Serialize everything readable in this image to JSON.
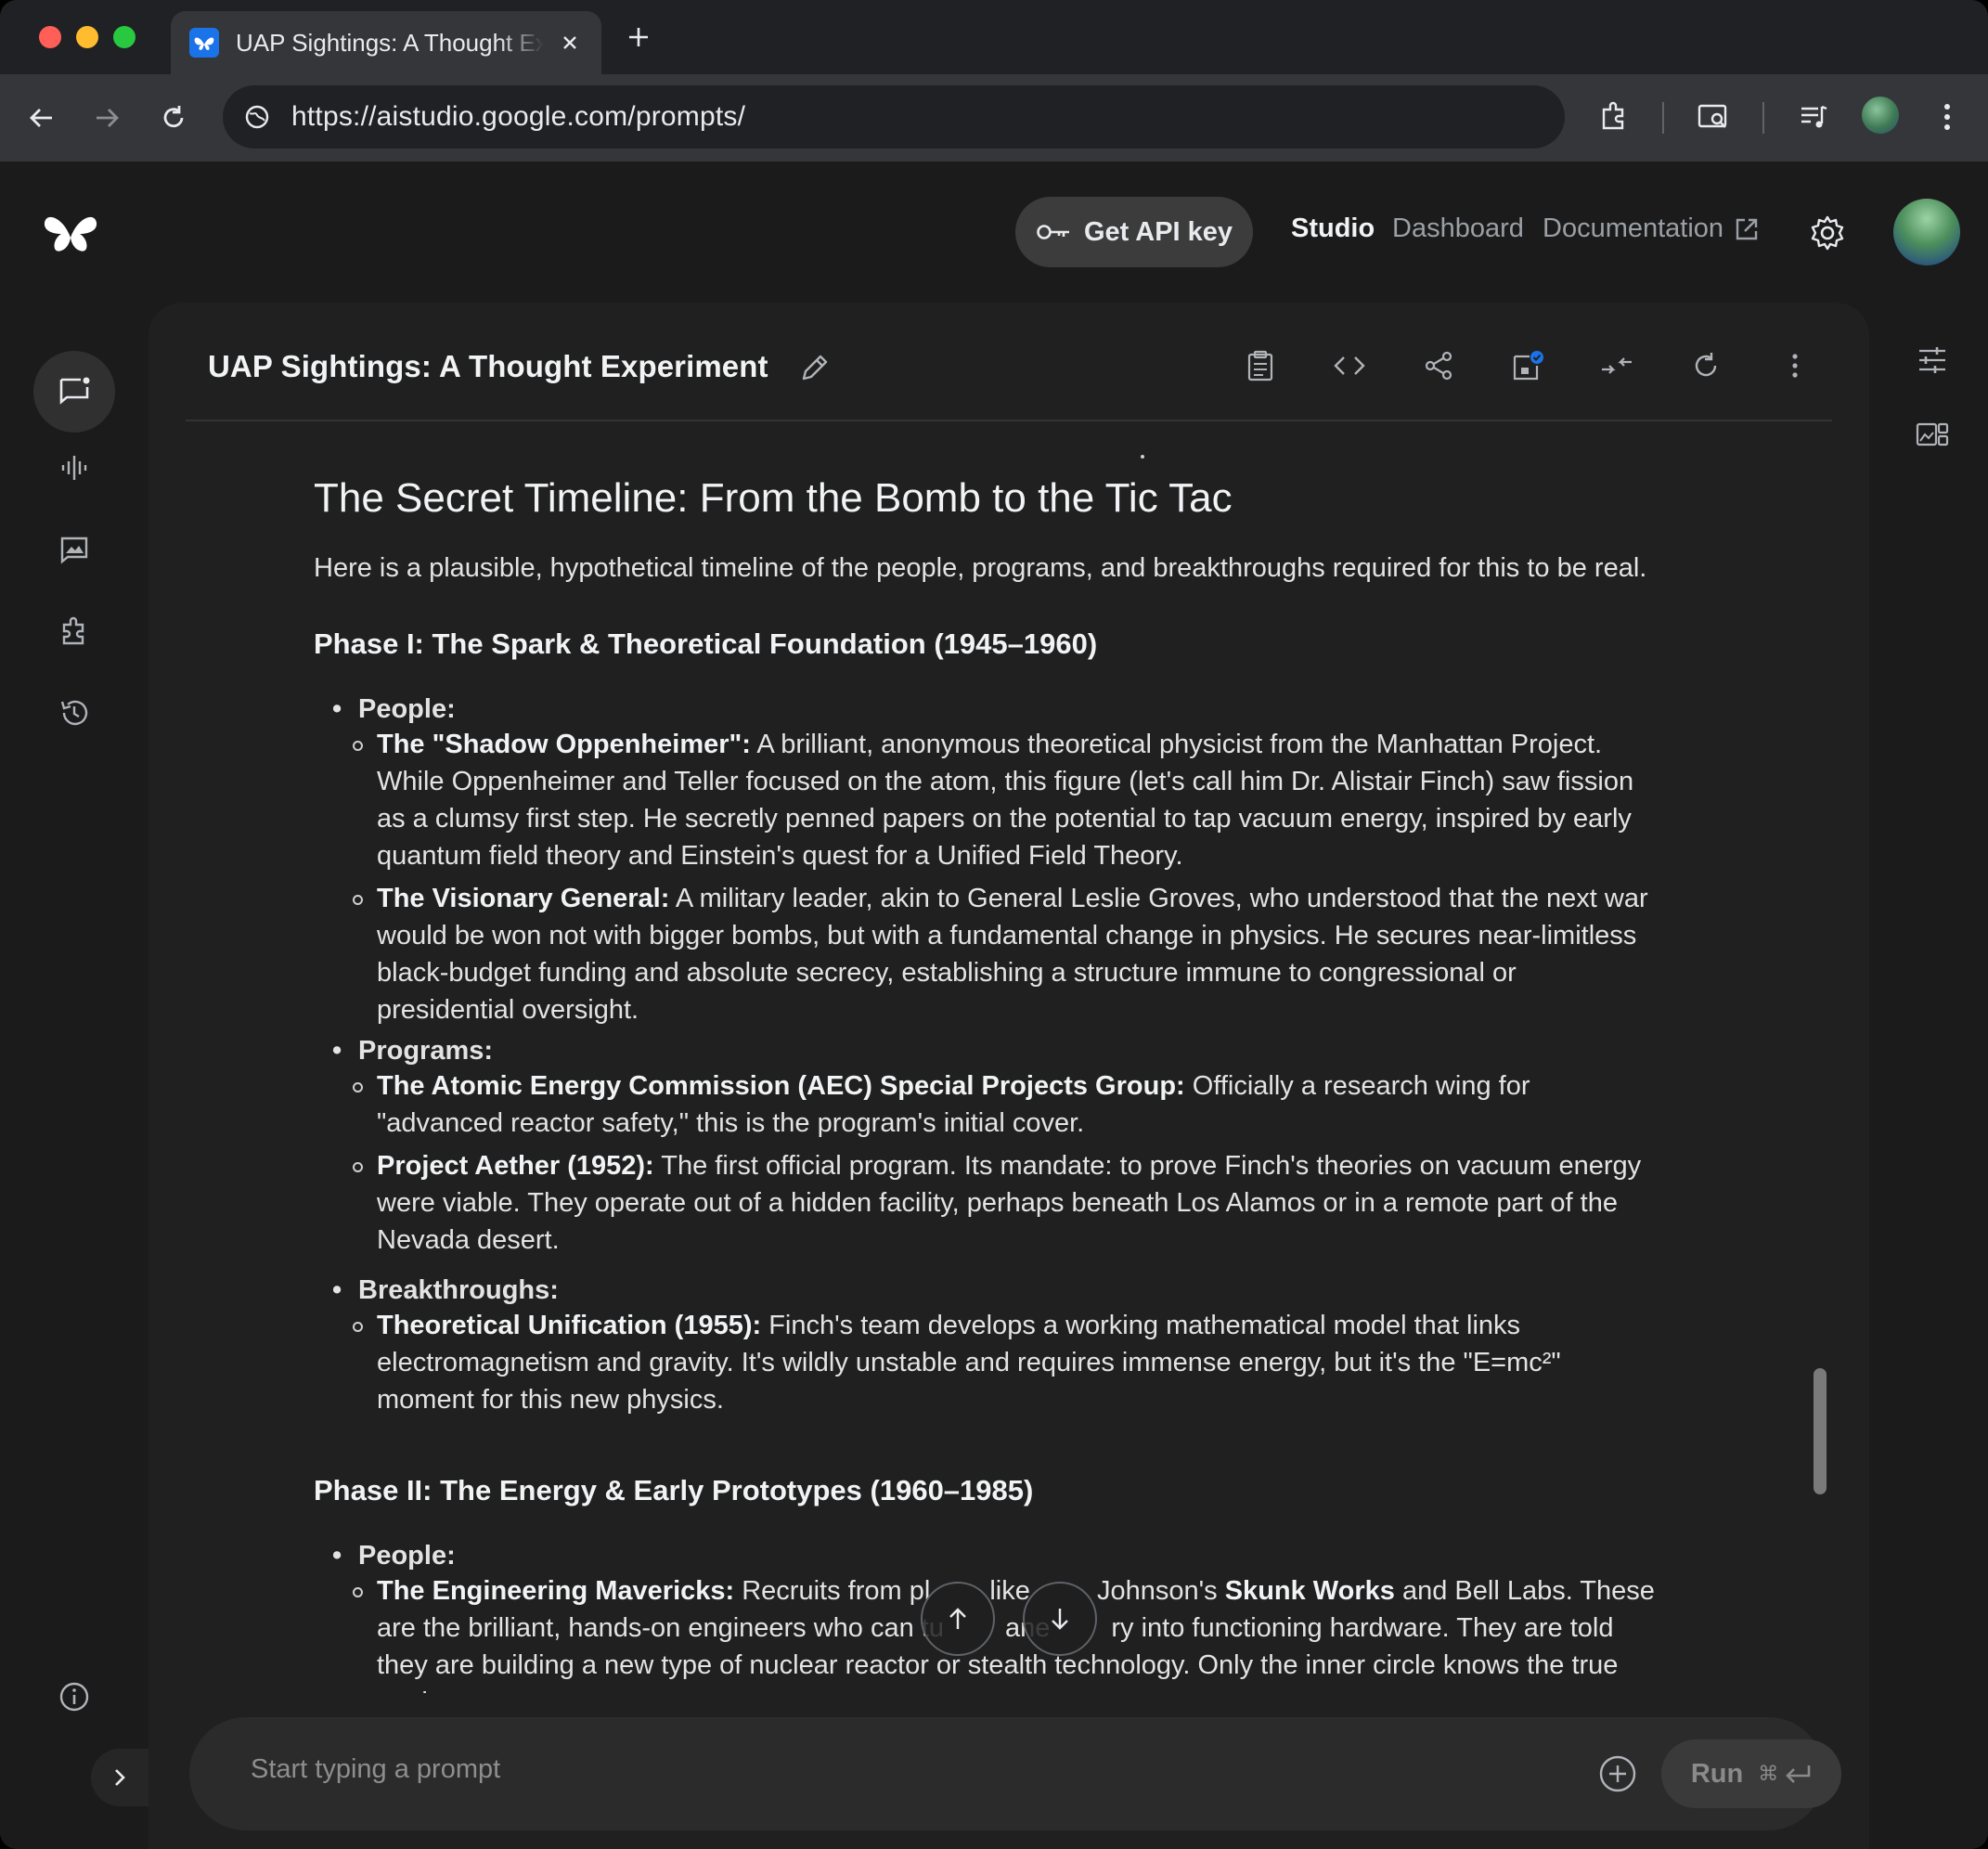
{
  "browser": {
    "tab_title": "UAP Sightings: A Thought Experiment",
    "url": "https://aistudio.google.com/prompts/"
  },
  "header": {
    "api_key_label": "Get API key",
    "nav": {
      "studio": "Studio",
      "dashboard": "Dashboard",
      "documentation": "Documentation"
    }
  },
  "prompt": {
    "title": "UAP Sightings: A Thought Experiment"
  },
  "response": {
    "section_title": "The Secret Timeline: From the Bomb to the Tic Tac",
    "intro": "Here is a plausible, hypothetical timeline of the people, programs, and breakthroughs required for this to be real.",
    "phases": [
      {
        "title": "Phase I: The Spark & Theoretical Foundation (1945–1960)",
        "groups": [
          {
            "label": "People:",
            "items": [
              {
                "term": "The \"Shadow Oppenheimer\":",
                "text": " A brilliant, anonymous theoretical physicist from the Manhattan Project. While Oppenheimer and Teller focused on the atom, this figure (let's call him Dr. Alistair Finch) saw fission as a clumsy first step. He secretly penned papers on the potential to tap vacuum energy, inspired by early quantum field theory and Einstein's quest for a Unified Field Theory."
              },
              {
                "term": "The Visionary General:",
                "text": " A military leader, akin to General Leslie Groves, who understood that the next war would be won not with bigger bombs, but with a fundamental change in physics. He secures near-limitless black-budget funding and absolute secrecy, establishing a structure immune to congressional or presidential oversight."
              }
            ]
          },
          {
            "label": "Programs:",
            "items": [
              {
                "term": "The Atomic Energy Commission (AEC) Special Projects Group:",
                "text": " Officially a research wing for \"advanced reactor safety,\" this is the program's initial cover."
              },
              {
                "term": "Project Aether (1952):",
                "text": " The first official program. Its mandate: to prove Finch's theories on vacuum energy were viable. They operate out of a hidden facility, perhaps beneath Los Alamos or in a remote part of the Nevada desert."
              }
            ]
          },
          {
            "label": "Breakthroughs:",
            "items": [
              {
                "term": "Theoretical Unification (1955):",
                "text": " Finch's team develops a working mathematical model that links electromagnetism and gravity. It's wildly unstable and requires immense energy, but it's the \"E=mc²\" moment for this new physics."
              }
            ]
          }
        ]
      },
      {
        "title": "Phase II: The Energy & Early Prototypes (1960–1985)",
        "groups": [
          {
            "label": "People:",
            "items": [
              {
                "term": "The Engineering Mavericks:",
                "text_a": " Recruits from pl",
                "text_b": " like ",
                "text_c": " Johnson's ",
                "term2": "Skunk Works",
                "text_d": " and Bell Labs. These are the brilliant, hands-on engineers who can tu",
                "text_e": "ane",
                "text_f": "ry into functioning hardware. They are told they are building a new type of nuclear reactor or stealth technology. Only the inner circle knows the true goal."
              }
            ]
          }
        ]
      }
    ]
  },
  "composer": {
    "placeholder": "Start typing a prompt",
    "run_label": "Run",
    "run_shortcut": "⌘"
  },
  "colors": {
    "background": "#1b1b1b",
    "panel": "#202020",
    "text": "#e3e3e3"
  }
}
